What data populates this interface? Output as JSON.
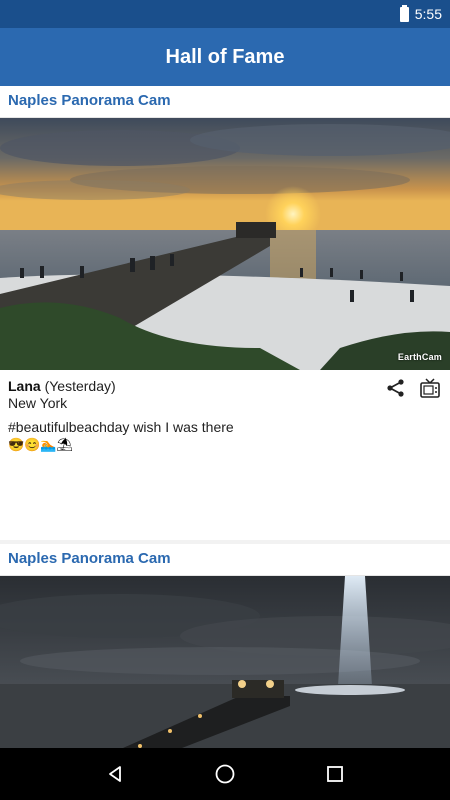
{
  "status_bar": {
    "time": "5:55"
  },
  "app_bar": {
    "title": "Hall of Fame"
  },
  "cards": [
    {
      "cam_title": "Naples Panorama Cam",
      "watermark": "EarthCam",
      "user": "Lana",
      "time": "(Yesterday)",
      "location": "New York",
      "text": "#beautifulbeachday wish I was there",
      "emoji": "😎😊🏊⛱"
    },
    {
      "cam_title": "Naples Panorama Cam"
    }
  ],
  "icons": {
    "share": "share-icon",
    "tv": "tv-icon",
    "back": "back-icon",
    "home": "home-icon",
    "recents": "recents-icon"
  }
}
